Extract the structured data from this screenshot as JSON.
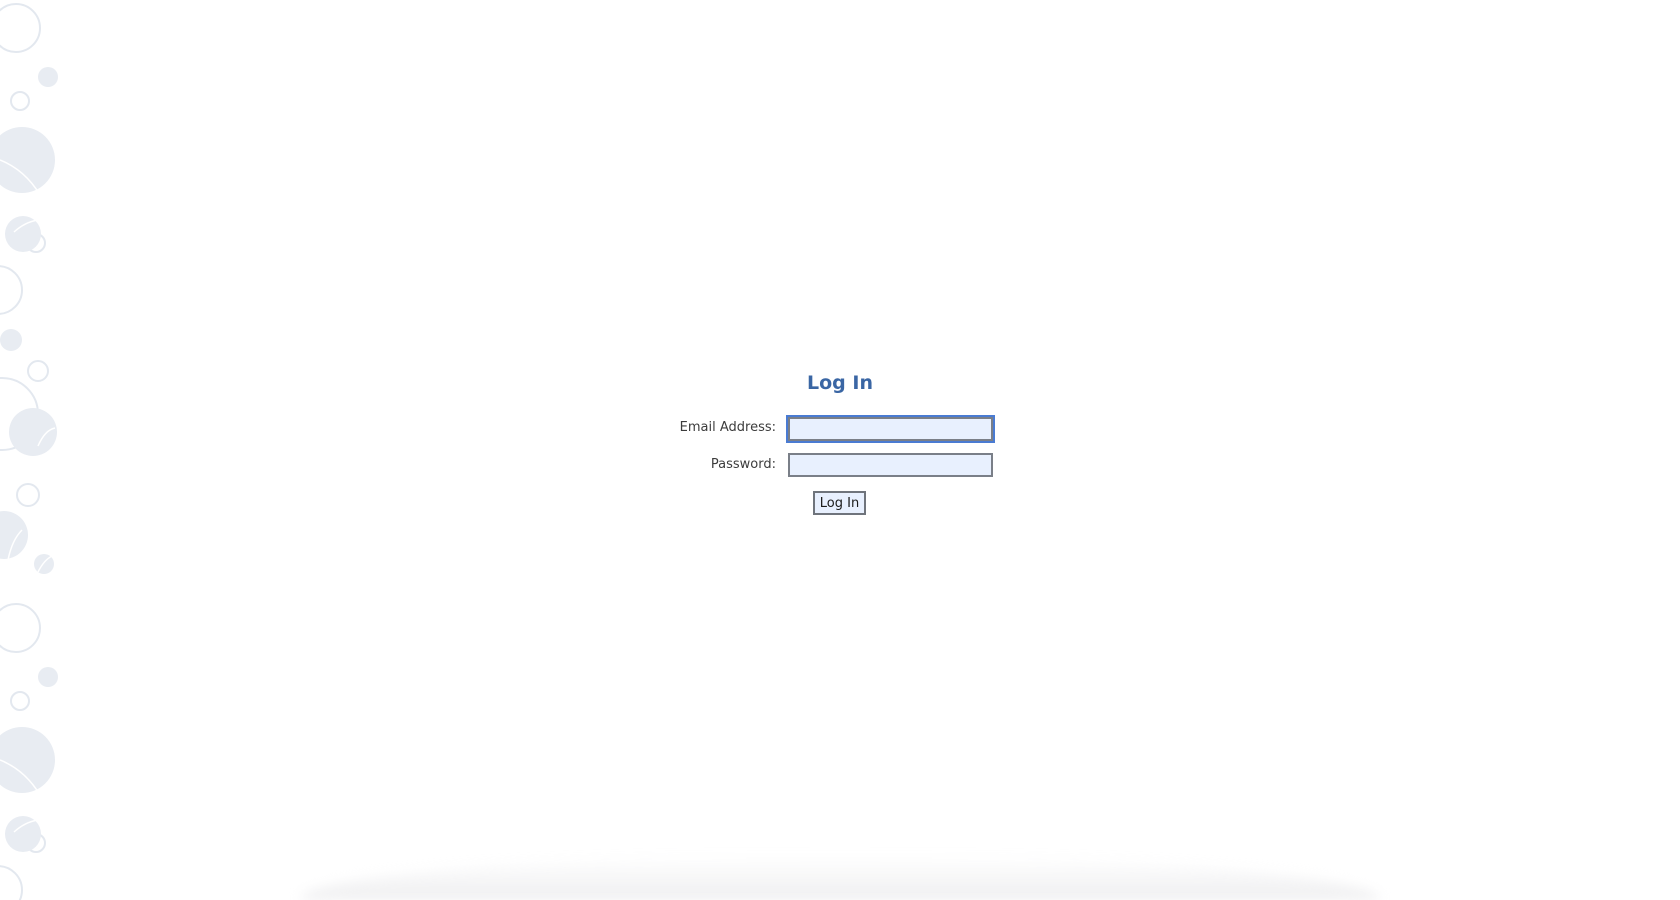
{
  "login": {
    "title": "Log In",
    "email_label": "Email Address:",
    "email_value": "",
    "password_label": "Password:",
    "password_value": "",
    "submit_label": "Log In"
  },
  "colors": {
    "title": "#3a66a4",
    "input_background": "#e8f0fe",
    "focus_ring": "#4a7bd2",
    "bubble": "#e8ecf2"
  }
}
